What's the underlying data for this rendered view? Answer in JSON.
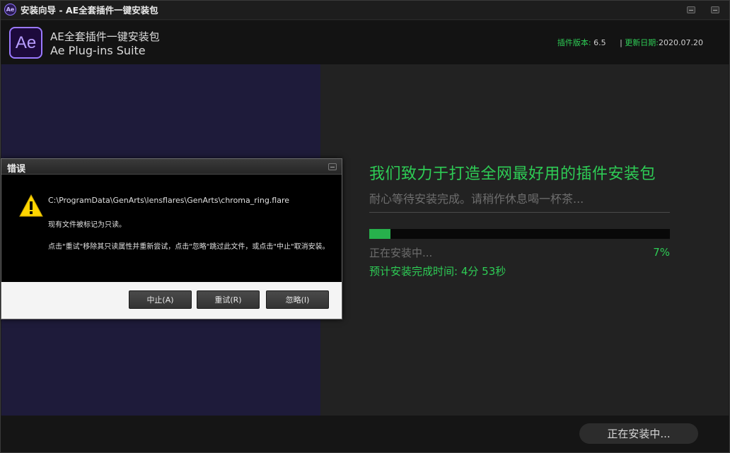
{
  "window": {
    "icon_text": "Ae",
    "title": "安装向导 - AE全套插件一键安装包"
  },
  "header": {
    "logo_text": "Ae",
    "name_cn": "AE全套插件一键安装包",
    "name_en": "Ae Plug-ins Suite",
    "version_label": "插件版本:",
    "version_value": "6.5",
    "date_label": "更新日期:",
    "date_value": "2020.07.20"
  },
  "main": {
    "headline": "我们致力于打造全网最好用的插件安装包",
    "subline": "耐心等待安装完成。请稍作休息喝一杯茶...",
    "progress_percent": 7,
    "status": "正在安装中...",
    "percent_text": "7%",
    "eta_label": "预计安装完成时间:",
    "eta_value": "4分 53秒"
  },
  "footer": {
    "button_label": "正在安装中..."
  },
  "dialog": {
    "title": "错误",
    "file_path": "C:\\ProgramData\\GenArts\\lensflares\\GenArts\\chroma_ring.flare",
    "message1": "现有文件被标记为只读。",
    "message2": "点击\"重试\"移除其只读属性并重新尝试，点击\"忽略\"跳过此文件，或点击\"中止\"取消安装。",
    "buttons": {
      "abort": "中止(A)",
      "retry": "重试(R)",
      "ignore": "忽略(I)"
    }
  },
  "colors": {
    "accent_green": "#2ecc55",
    "progress_fill": "#27b14c",
    "logo_purple": "#9b79ff"
  }
}
